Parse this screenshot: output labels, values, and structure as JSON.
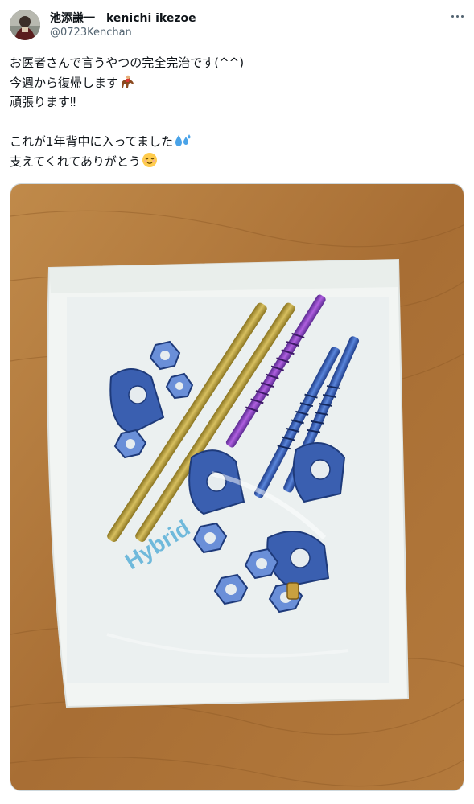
{
  "tweet": {
    "display_name": "池添謙一　kenichi ikezoe",
    "handle": "@0723Kenchan",
    "more_icon": "more-horizontal-icon",
    "lines": [
      {
        "text": "お医者さんで言うやつの完全完治です(^^)",
        "emoji": ""
      },
      {
        "text": "今週から復帰します",
        "emoji": "horse-racing-emoji"
      },
      {
        "text": "頑張ります‼︎",
        "emoji": ""
      },
      {
        "text": "",
        "emoji": ""
      },
      {
        "text": "これが1年背中に入ってました",
        "emoji": "sweat-droplets-emoji"
      },
      {
        "text": "支えてくれてありがとう",
        "emoji": "relieved-face-emoji"
      }
    ],
    "media": {
      "icon": "photo",
      "package_label": "Hybrid",
      "colors": {
        "table": "#b07a3e",
        "titanium_blue": "#3a5fb0",
        "gold_rod": "#b89a3a",
        "purple_screw": "#8a3fb8"
      }
    }
  }
}
